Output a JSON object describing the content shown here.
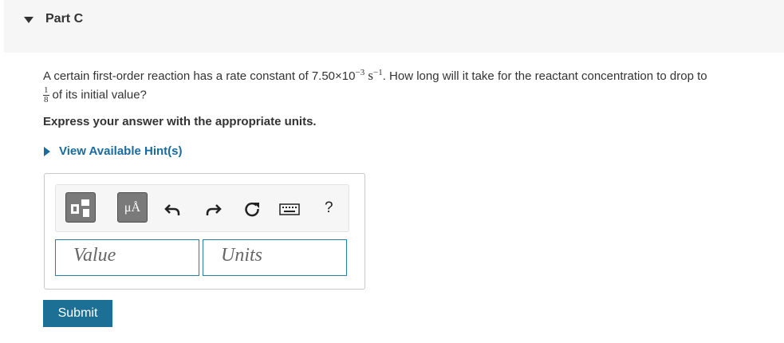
{
  "part": {
    "title": "Part C",
    "toggle_icon": "caret-down-icon"
  },
  "question": {
    "text_before": "A certain first-order reaction has a rate constant of 7.50×10",
    "exponent": "−3",
    "unit_base": "s",
    "unit_exponent": "−1",
    "text_after": ". How long will it take for the reactant concentration to drop to",
    "fraction_numerator": "1",
    "fraction_denominator": "8",
    "text_end": "of its initial value?"
  },
  "instruction": "Express your answer with the appropriate units.",
  "hints": {
    "label": "View Available Hint(s)",
    "icon": "caret-right-icon"
  },
  "toolbar": {
    "templates_icon": "templates-icon",
    "units_button_label": "μÅ",
    "undo_icon": "undo-icon",
    "redo_icon": "redo-icon",
    "reset_icon": "reset-icon",
    "keyboard_icon": "keyboard-icon",
    "help_label": "?"
  },
  "inputs": {
    "value_placeholder": "Value",
    "units_placeholder": "Units"
  },
  "submit_label": "Submit",
  "colors": {
    "link": "#196b9d",
    "submit_bg": "#1c7095",
    "input_border": "#2a7fae",
    "header_bg": "#f6f6f6"
  }
}
